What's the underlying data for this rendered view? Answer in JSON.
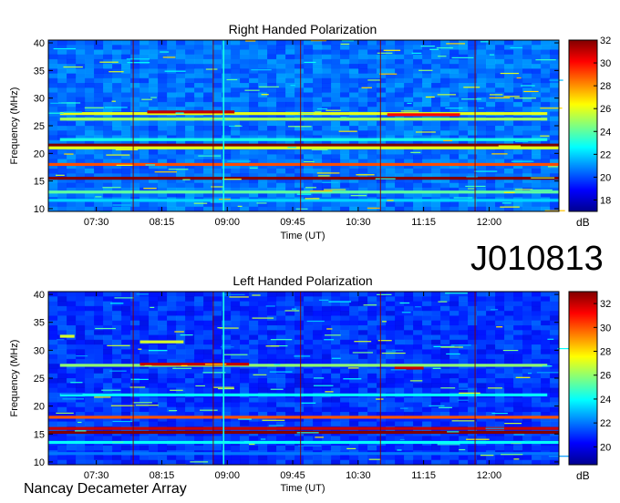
{
  "figure": {
    "observation_id": "J010813",
    "instrument": "Nancay Decameter Array"
  },
  "chart_data": [
    {
      "type": "heatmap",
      "title": "Right Handed Polarization",
      "xlabel": "Time (UT)",
      "ylabel": "Frequency (MHz)",
      "xticks": [
        "07:30",
        "08:15",
        "09:00",
        "09:45",
        "10:30",
        "11:15",
        "12:00"
      ],
      "x_range": [
        "06:57",
        "12:48"
      ],
      "yticks": [
        10,
        15,
        20,
        25,
        30,
        35,
        40
      ],
      "ylim": [
        9.5,
        40.5
      ],
      "colorbar": {
        "label": "dB",
        "ticks": [
          18,
          20,
          22,
          24,
          26,
          28,
          30,
          32
        ],
        "range": [
          17,
          32
        ],
        "colormap": "jet"
      },
      "background_level_db": 20.5,
      "emission_bands": [
        {
          "freq_mhz": 27.2,
          "time_start": "07:05",
          "time_end": "12:40",
          "level_db": 26
        },
        {
          "freq_mhz": 27.5,
          "time_start": "08:05",
          "time_end": "09:05",
          "level_db": 31
        },
        {
          "freq_mhz": 27.0,
          "time_start": "10:50",
          "time_end": "11:40",
          "level_db": 30
        },
        {
          "freq_mhz": 26.2,
          "time_start": "07:05",
          "time_end": "12:40",
          "level_db": 25
        },
        {
          "freq_mhz": 22.5,
          "time_start": "07:05",
          "time_end": "12:40",
          "level_db": 23
        },
        {
          "freq_mhz": 21.5,
          "time_start": "06:57",
          "time_end": "12:48",
          "level_db": 32
        },
        {
          "freq_mhz": 21.0,
          "time_start": "06:57",
          "time_end": "12:48",
          "level_db": 26
        },
        {
          "freq_mhz": 18.0,
          "time_start": "06:57",
          "time_end": "12:48",
          "level_db": 29
        },
        {
          "freq_mhz": 15.5,
          "time_start": "06:57",
          "time_end": "12:48",
          "level_db": 32
        },
        {
          "freq_mhz": 13.0,
          "time_start": "06:57",
          "time_end": "12:48",
          "level_db": 24
        },
        {
          "freq_mhz": 11.5,
          "time_start": "06:57",
          "time_end": "12:48",
          "level_db": 22
        }
      ],
      "interference_columns": [
        "07:55",
        "08:50",
        "09:50",
        "10:45",
        "11:50"
      ],
      "bright_column": "08:57"
    },
    {
      "type": "heatmap",
      "title": "Left Handed Polarization",
      "xlabel": "Time (UT)",
      "ylabel": "Frequency (MHz)",
      "xticks": [
        "07:30",
        "08:15",
        "09:00",
        "09:45",
        "10:30",
        "11:15",
        "12:00"
      ],
      "x_range": [
        "06:57",
        "12:48"
      ],
      "yticks": [
        10,
        15,
        20,
        25,
        30,
        35,
        40
      ],
      "ylim": [
        9.5,
        40.5
      ],
      "colorbar": {
        "label": "dB",
        "ticks": [
          20,
          22,
          24,
          26,
          28,
          30,
          32
        ],
        "range": [
          18.5,
          33
        ],
        "colormap": "jet"
      },
      "background_level_db": 21,
      "emission_bands": [
        {
          "freq_mhz": 27.3,
          "time_start": "07:05",
          "time_end": "12:40",
          "level_db": 26
        },
        {
          "freq_mhz": 27.5,
          "time_start": "08:00",
          "time_end": "09:15",
          "level_db": 32
        },
        {
          "freq_mhz": 26.8,
          "time_start": "10:55",
          "time_end": "11:15",
          "level_db": 32
        },
        {
          "freq_mhz": 32.5,
          "time_start": "07:05",
          "time_end": "07:15",
          "level_db": 27
        },
        {
          "freq_mhz": 31.5,
          "time_start": "08:00",
          "time_end": "08:30",
          "level_db": 27
        },
        {
          "freq_mhz": 22.0,
          "time_start": "07:05",
          "time_end": "12:40",
          "level_db": 24
        },
        {
          "freq_mhz": 18.0,
          "time_start": "06:57",
          "time_end": "12:48",
          "level_db": 30
        },
        {
          "freq_mhz": 16.0,
          "time_start": "06:57",
          "time_end": "12:48",
          "level_db": 32
        },
        {
          "freq_mhz": 15.3,
          "time_start": "06:57",
          "time_end": "12:48",
          "level_db": 33
        },
        {
          "freq_mhz": 13.5,
          "time_start": "06:57",
          "time_end": "12:48",
          "level_db": 24
        },
        {
          "freq_mhz": 11.5,
          "time_start": "06:57",
          "time_end": "12:48",
          "level_db": 22
        }
      ],
      "interference_columns": [
        "07:55",
        "08:50",
        "09:50",
        "10:45",
        "11:50"
      ],
      "bright_column": "08:57"
    }
  ]
}
